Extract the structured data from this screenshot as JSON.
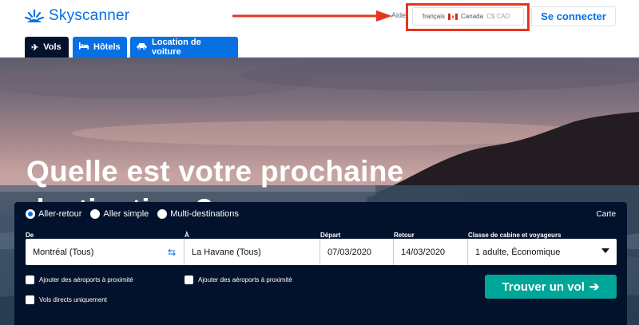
{
  "header": {
    "logo_text": "Skyscanner",
    "help_label": "Aide",
    "locale": {
      "language": "français",
      "country": "Canada",
      "currency": "C$ CAD"
    },
    "login_label": "Se connecter"
  },
  "tabs": [
    {
      "label": "Vols",
      "icon": "plane-icon",
      "active": true
    },
    {
      "label": "Hôtels",
      "icon": "bed-icon",
      "active": false
    },
    {
      "label": "Location de voiture",
      "icon": "car-icon",
      "active": false
    }
  ],
  "hero": {
    "title_line1": "Quelle est votre prochaine",
    "title_line2": "destination ?"
  },
  "search": {
    "trip_types": [
      {
        "label": "Aller-retour",
        "selected": true
      },
      {
        "label": "Aller simple",
        "selected": false
      },
      {
        "label": "Multi-destinations",
        "selected": false
      }
    ],
    "map_label": "Carte",
    "labels": {
      "from": "De",
      "to": "À",
      "depart": "Départ",
      "return": "Retour",
      "cabin": "Classe de cabine et voyageurs"
    },
    "values": {
      "from": "Montréal (Tous)",
      "to": "La Havane (Tous)",
      "depart": "07/03/2020",
      "return": "14/03/2020",
      "cabin": "1 adulte, Économique"
    },
    "checkboxes": {
      "nearby_from": "Ajouter des aéroports à proximité",
      "nearby_to": "Ajouter des aéroports à proximité",
      "direct": "Vols directs uniquement"
    },
    "submit_label": "Trouver un vol",
    "submit_arrow": "➔"
  },
  "colors": {
    "brand_blue": "#0770e3",
    "navy": "#02122c",
    "cta_green": "#00a698",
    "annotation_red": "#e4371e"
  }
}
